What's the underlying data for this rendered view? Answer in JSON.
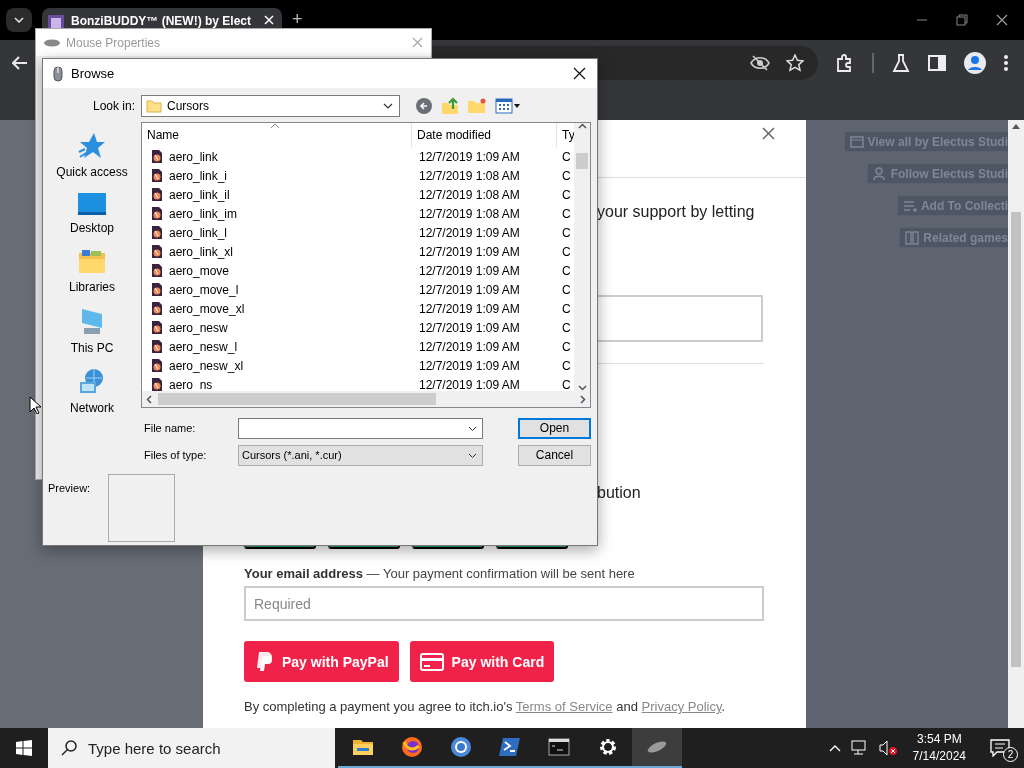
{
  "browser": {
    "tab_title": "BonziBUDDY™ (NEW!) by Elect",
    "new_tab": "+"
  },
  "page": {
    "intro_text": "your support by letting",
    "contribution_text": "bution",
    "email_label": "Your email address",
    "email_hint": "— Your payment confirmation will be sent here",
    "email_placeholder": "Required",
    "pay_buttons": [
      {
        "label": "Pay with PayPal",
        "kind": "paypal"
      },
      {
        "label": "Pay with Card",
        "kind": "card"
      }
    ],
    "terms": {
      "text": "By completing a payment you agree to itch.io's",
      "link_1": "Terms of Service",
      "joiner": "and",
      "link_2": "Privacy Policy",
      "end": "."
    },
    "side_buttons": [
      {
        "label": "View all by Electus Studi",
        "kind": "store"
      },
      {
        "label": "Follow Electus Studi",
        "kind": "follow"
      },
      {
        "label": "Add To Collecti",
        "kind": "collection"
      },
      {
        "label": "Related games",
        "kind": "related"
      }
    ]
  },
  "mouse_properties": {
    "title": "Mouse Properties"
  },
  "browse": {
    "title": "Browse",
    "look_in_label": "Look in:",
    "look_in": "Cursors",
    "places": [
      {
        "label": "Quick access",
        "kind": "star"
      },
      {
        "label": "Desktop",
        "kind": "desktop"
      },
      {
        "label": "Libraries",
        "kind": "libraries"
      },
      {
        "label": "This PC",
        "kind": "pc"
      },
      {
        "label": "Network",
        "kind": "network"
      }
    ],
    "columns": [
      "Name",
      "Date modified",
      "Ty"
    ],
    "files": [
      {
        "name": "aero_link",
        "date": "12/7/2019 1:09 AM",
        "type": "C"
      },
      {
        "name": "aero_link_i",
        "date": "12/7/2019 1:08 AM",
        "type": "C"
      },
      {
        "name": "aero_link_il",
        "date": "12/7/2019 1:08 AM",
        "type": "C"
      },
      {
        "name": "aero_link_im",
        "date": "12/7/2019 1:08 AM",
        "type": "C"
      },
      {
        "name": "aero_link_l",
        "date": "12/7/2019 1:09 AM",
        "type": "C"
      },
      {
        "name": "aero_link_xl",
        "date": "12/7/2019 1:09 AM",
        "type": "C"
      },
      {
        "name": "aero_move",
        "date": "12/7/2019 1:09 AM",
        "type": "C"
      },
      {
        "name": "aero_move_l",
        "date": "12/7/2019 1:09 AM",
        "type": "C"
      },
      {
        "name": "aero_move_xl",
        "date": "12/7/2019 1:09 AM",
        "type": "C"
      },
      {
        "name": "aero_nesw",
        "date": "12/7/2019 1:09 AM",
        "type": "C"
      },
      {
        "name": "aero_nesw_l",
        "date": "12/7/2019 1:09 AM",
        "type": "C"
      },
      {
        "name": "aero_nesw_xl",
        "date": "12/7/2019 1:09 AM",
        "type": "C"
      },
      {
        "name": "aero_ns",
        "date": "12/7/2019 1:09 AM",
        "type": "C"
      }
    ],
    "file_name_label": "File name:",
    "files_of_type_label": "Files of type:",
    "file_type": "Cursors (*.ani, *.cur)",
    "open_button": "Open",
    "cancel_button": "Cancel",
    "preview_label": "Preview:"
  },
  "taskbar": {
    "search_placeholder": "Type here to search",
    "time": "3:54 PM",
    "date": "7/14/2024",
    "notifications": "2"
  }
}
